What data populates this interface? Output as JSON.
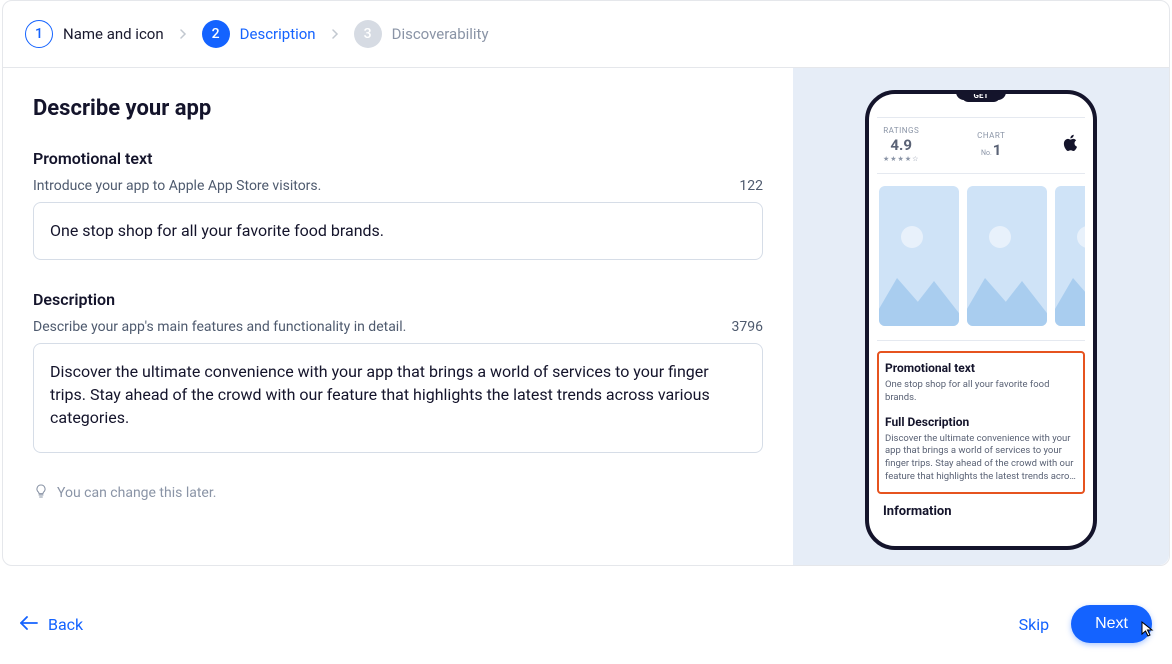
{
  "stepper": {
    "steps": [
      {
        "num": "1",
        "label": "Name and icon"
      },
      {
        "num": "2",
        "label": "Description"
      },
      {
        "num": "3",
        "label": "Discoverability"
      }
    ]
  },
  "page": {
    "title": "Describe your app"
  },
  "promo": {
    "label": "Promotional text",
    "help": "Introduce your app to Apple App Store visitors.",
    "counter": "122",
    "value": "One stop shop for all your favorite food brands."
  },
  "desc": {
    "label": "Description",
    "help": "Describe your app's main features and functionality in detail.",
    "counter": "3796",
    "value": "Discover the ultimate convenience with your app that brings a world of services to your finger trips. Stay ahead of the crowd with our feature that highlights the latest trends across various categories."
  },
  "hint": "You can change this later.",
  "preview": {
    "ratings_label": "RATINGS",
    "ratings_value": "4.9",
    "chart_label": "CHART",
    "chart_no": "No.",
    "chart_value": "1",
    "promo_title": "Promotional text",
    "promo_text": "One stop shop for all your favorite food brands.",
    "full_title": "Full Description",
    "full_text": "Discover the ultimate convenience with your app that brings a world of services to your finger trips. Stay ahead of the crowd with our feature that highlights the latest trends acro…",
    "info_title": "Information",
    "get_label": "GET"
  },
  "footer": {
    "back": "Back",
    "skip": "Skip",
    "next": "Next"
  }
}
